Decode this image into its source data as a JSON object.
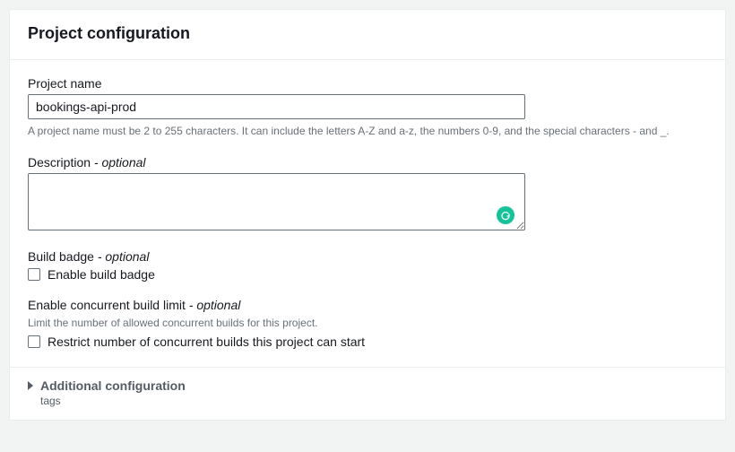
{
  "header": {
    "title": "Project configuration"
  },
  "projectName": {
    "label": "Project name",
    "value": "bookings-api-prod",
    "helper": "A project name must be 2 to 255 characters. It can include the letters A-Z and a-z, the numbers 0-9, and the special characters - and _."
  },
  "description": {
    "label": "Description",
    "optional": " - optional",
    "value": ""
  },
  "buildBadge": {
    "label": "Build badge",
    "optional": " - optional",
    "checkboxLabel": "Enable build badge"
  },
  "concurrentLimit": {
    "label": "Enable concurrent build limit",
    "optional": " - optional",
    "helper": "Limit the number of allowed concurrent builds for this project.",
    "checkboxLabel": "Restrict number of concurrent builds this project can start"
  },
  "additional": {
    "label": "Additional configuration",
    "sub": "tags"
  }
}
